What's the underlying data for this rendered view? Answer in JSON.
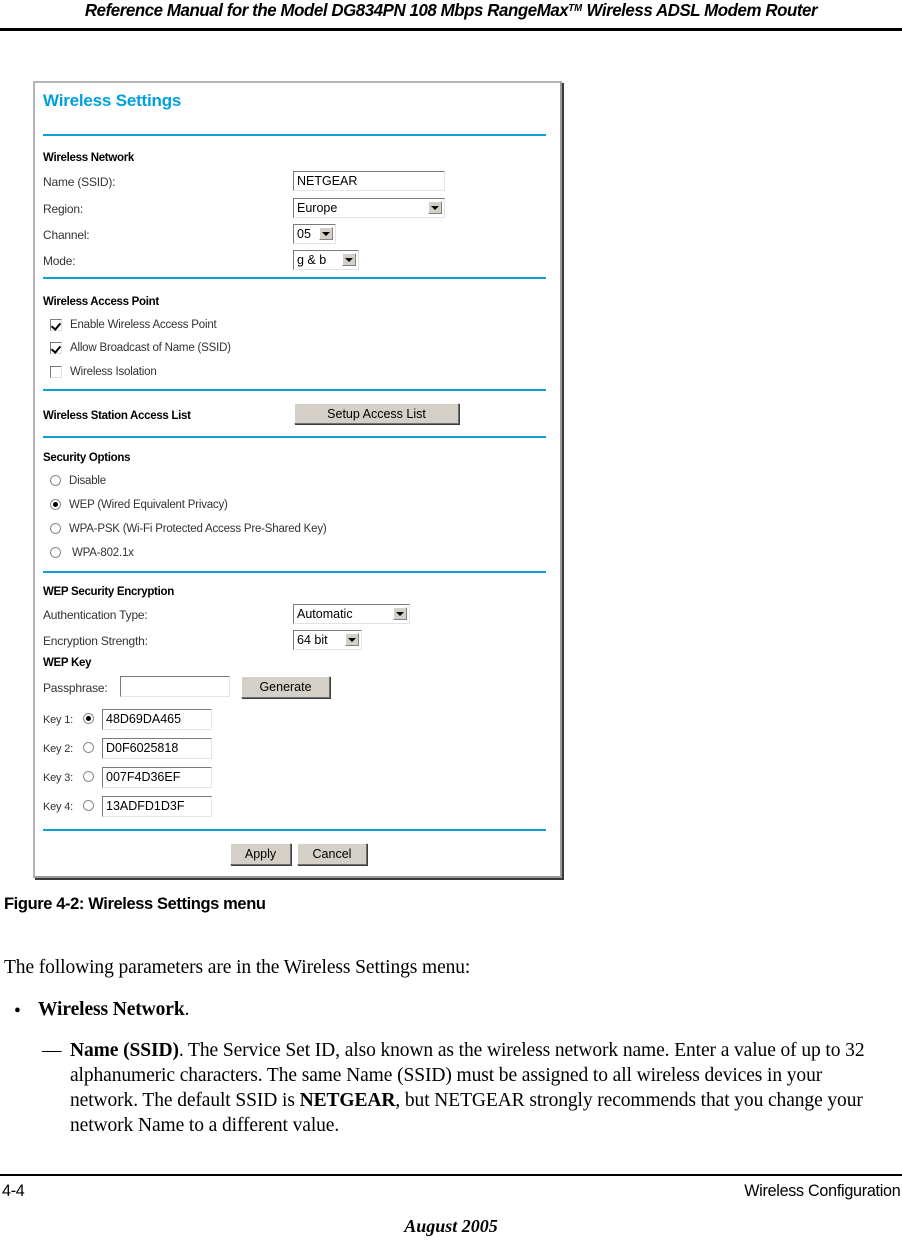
{
  "header": {
    "title_before": "Reference Manual for the Model DG834PN 108 Mbps RangeMax",
    "title_sup": "TM",
    "title_after": " Wireless ADSL Modem Router"
  },
  "panel": {
    "title": "Wireless Settings",
    "accent_color": "#00a0e0",
    "divider_color": "#0fa0d8",
    "wireless_network": {
      "section_label": "Wireless Network",
      "fields": [
        {
          "label": "Name (SSID):",
          "type": "text",
          "value": "NETGEAR"
        },
        {
          "label": "Region:",
          "type": "select",
          "value": "Europe"
        },
        {
          "label": "Channel:",
          "type": "select",
          "value": "05"
        },
        {
          "label": "Mode:",
          "type": "select",
          "value": "g & b"
        }
      ]
    },
    "wireless_access_point": {
      "section_label": "Wireless Access Point",
      "checkboxes": [
        {
          "label": "Enable Wireless Access Point",
          "checked": true
        },
        {
          "label": "Allow Broadcast of Name (SSID)",
          "checked": true
        },
        {
          "label": "Wireless Isolation",
          "checked": false
        }
      ]
    },
    "station_access_list": {
      "section_label": "Wireless Station Access List",
      "button_label": "Setup Access List"
    },
    "security_options": {
      "section_label": "Security Options",
      "options": [
        {
          "label": "Disable",
          "selected": false
        },
        {
          "label": "WEP (Wired Equivalent Privacy)",
          "selected": true
        },
        {
          "label": "WPA-PSK (Wi-Fi Protected Access Pre-Shared Key)",
          "selected": false
        },
        {
          "label": "WPA-802.1x",
          "selected": false
        }
      ]
    },
    "wep_encryption": {
      "section_label": "WEP Security Encryption",
      "auth_type_label": "Authentication Type:",
      "auth_type_value": "Automatic",
      "strength_label": "Encryption Strength:",
      "strength_value": "64 bit",
      "wep_key_label": "WEP Key",
      "passphrase_label": "Passphrase:",
      "passphrase_value": "",
      "generate_label": "Generate",
      "keys": [
        {
          "label": "Key 1:",
          "value": "48D69DA465",
          "selected": true
        },
        {
          "label": "Key 2:",
          "value": "D0F6025818",
          "selected": false
        },
        {
          "label": "Key 3:",
          "value": "007F4D36EF",
          "selected": false
        },
        {
          "label": "Key 4:",
          "value": "13ADFD1D3F",
          "selected": false
        }
      ]
    },
    "actions": {
      "apply_label": "Apply",
      "cancel_label": "Cancel"
    }
  },
  "figure": {
    "caption": "Figure 4-2:  Wireless Settings menu"
  },
  "body": {
    "intro": "The following parameters are in the Wireless Settings menu:",
    "bullet_marker": "•",
    "bullet_term": "Wireless Network",
    "bullet_rest": ".",
    "dash_marker": "—",
    "dash_term": "Name (SSID)",
    "dash_text_1": ". The Service Set ID, also known as the wireless network name. Enter a value of up to 32 alphanumeric characters. The same Name (SSID) must be assigned to all wireless devices in your network. The default SSID is ",
    "dash_bold_2": "NETGEAR",
    "dash_text_3": ", but NETGEAR strongly recommends that you change your network Name to a different value."
  },
  "footer": {
    "page_number": "4-4",
    "section": "Wireless Configuration",
    "date": "August 2005"
  }
}
